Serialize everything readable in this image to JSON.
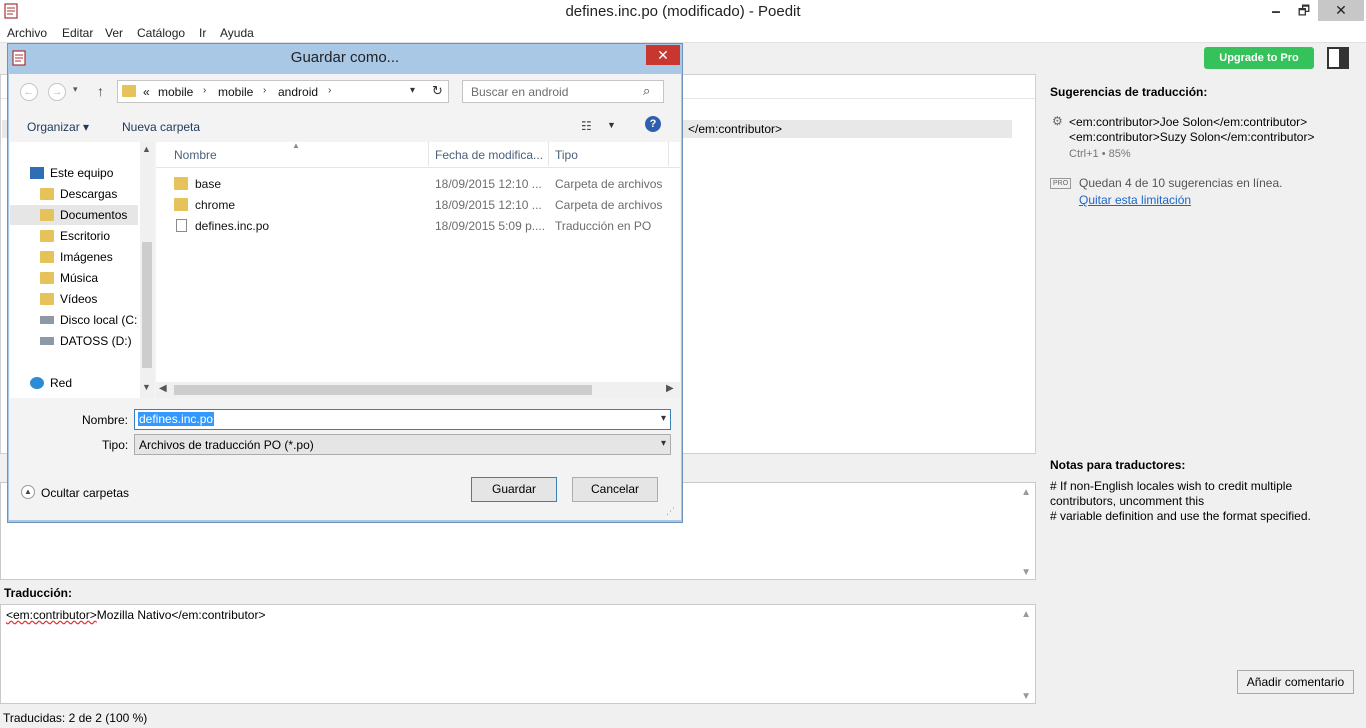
{
  "window": {
    "title": "defines.inc.po (modificado) - Poedit",
    "min": "🗕",
    "max": "🗗",
    "close": "✕"
  },
  "menu": [
    "Archivo",
    "Editar",
    "Ver",
    "Catálogo",
    "Ir",
    "Ayuda"
  ],
  "toolbar": {
    "upgrade_label": "Upgrade to Pro",
    "accent": "#36c25a"
  },
  "list": {
    "selected_row_text": "</em:contributor>"
  },
  "translation": {
    "label": "Traducción:",
    "tag_part": "<em:contributor>",
    "rest": "Mozilla Nativo</em:contributor>"
  },
  "status": {
    "text": "Traducidas: 2 de 2 (100 %)"
  },
  "sidebar": {
    "suggestions_title": "Sugerencias de traducción:",
    "suggestion_line1": "<em:contributor>Joe Solon</em:contributor>",
    "suggestion_line2": "<em:contributor>Suzy Solon</em:contributor>",
    "suggestion_meta": "Ctrl+1 • 85%",
    "pro_badge": "PRO",
    "pro_text": "Quedan 4 de 10 sugerencias en línea.",
    "pro_link": "Quitar esta limitación",
    "notes_title": "Notas para traductores:",
    "notes_lines": [
      "# If non-English locales wish to credit multiple",
      "contributors, uncomment this",
      "# variable definition and use the format specified."
    ],
    "add_comment_label": "Añadir comentario"
  },
  "dialog": {
    "title": "Guardar como...",
    "close": "✕",
    "breadcrumb": [
      "«",
      "mobile",
      "mobile",
      "android"
    ],
    "search_placeholder": "Buscar en android",
    "organize_label": "Organizar ▾",
    "new_folder_label": "Nueva carpeta",
    "nav_items": [
      "Este equipo",
      "Descargas",
      "Documentos",
      "Escritorio",
      "Imágenes",
      "Música",
      "Vídeos",
      "Disco local (C:)",
      "DATOSS (D:)",
      "Red"
    ],
    "columns": [
      "Nombre",
      "Fecha de modifica...",
      "Tipo"
    ],
    "files": [
      {
        "name": "base",
        "date": "18/09/2015 12:10 ...",
        "type": "Carpeta de archivos"
      },
      {
        "name": "chrome",
        "date": "18/09/2015 12:10 ...",
        "type": "Carpeta de archivos"
      },
      {
        "name": "defines.inc.po",
        "date": "18/09/2015 5:09 p....",
        "type": "Traducción en PO"
      }
    ],
    "name_label": "Nombre:",
    "name_value": "defines.inc.po",
    "type_label": "Tipo:",
    "type_value": "Archivos de traducción PO (*.po)",
    "hide_folders_label": "Ocultar carpetas",
    "save_label": "Guardar",
    "cancel_label": "Cancelar"
  }
}
